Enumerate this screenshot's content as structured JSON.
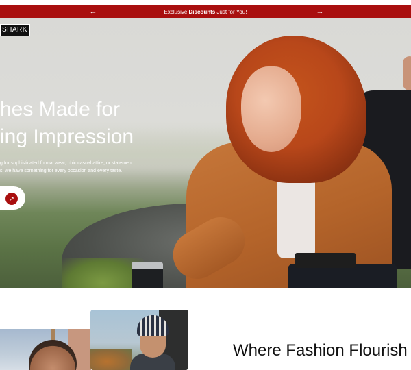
{
  "promo_bar": {
    "prefix": "Exclusive ",
    "highlight": "Discounts",
    "suffix": " Just for You!",
    "prev_icon": "arrow-left-icon",
    "next_icon": "arrow-right-icon",
    "background_color": "#a90f0f"
  },
  "header": {
    "logo_text": "SHARK"
  },
  "hero": {
    "headline_line1": "hes Made for",
    "headline_line2": "ing Impression",
    "subtext_line1": "g for sophisticated formal wear, chic casual attire, or statement",
    "subtext_line2": "s, we have something for every occasion and every taste.",
    "cta_icon": "arrow-up-right-icon",
    "accent_color": "#a90f0f"
  },
  "section": {
    "title": "Where Fashion Flourish"
  }
}
